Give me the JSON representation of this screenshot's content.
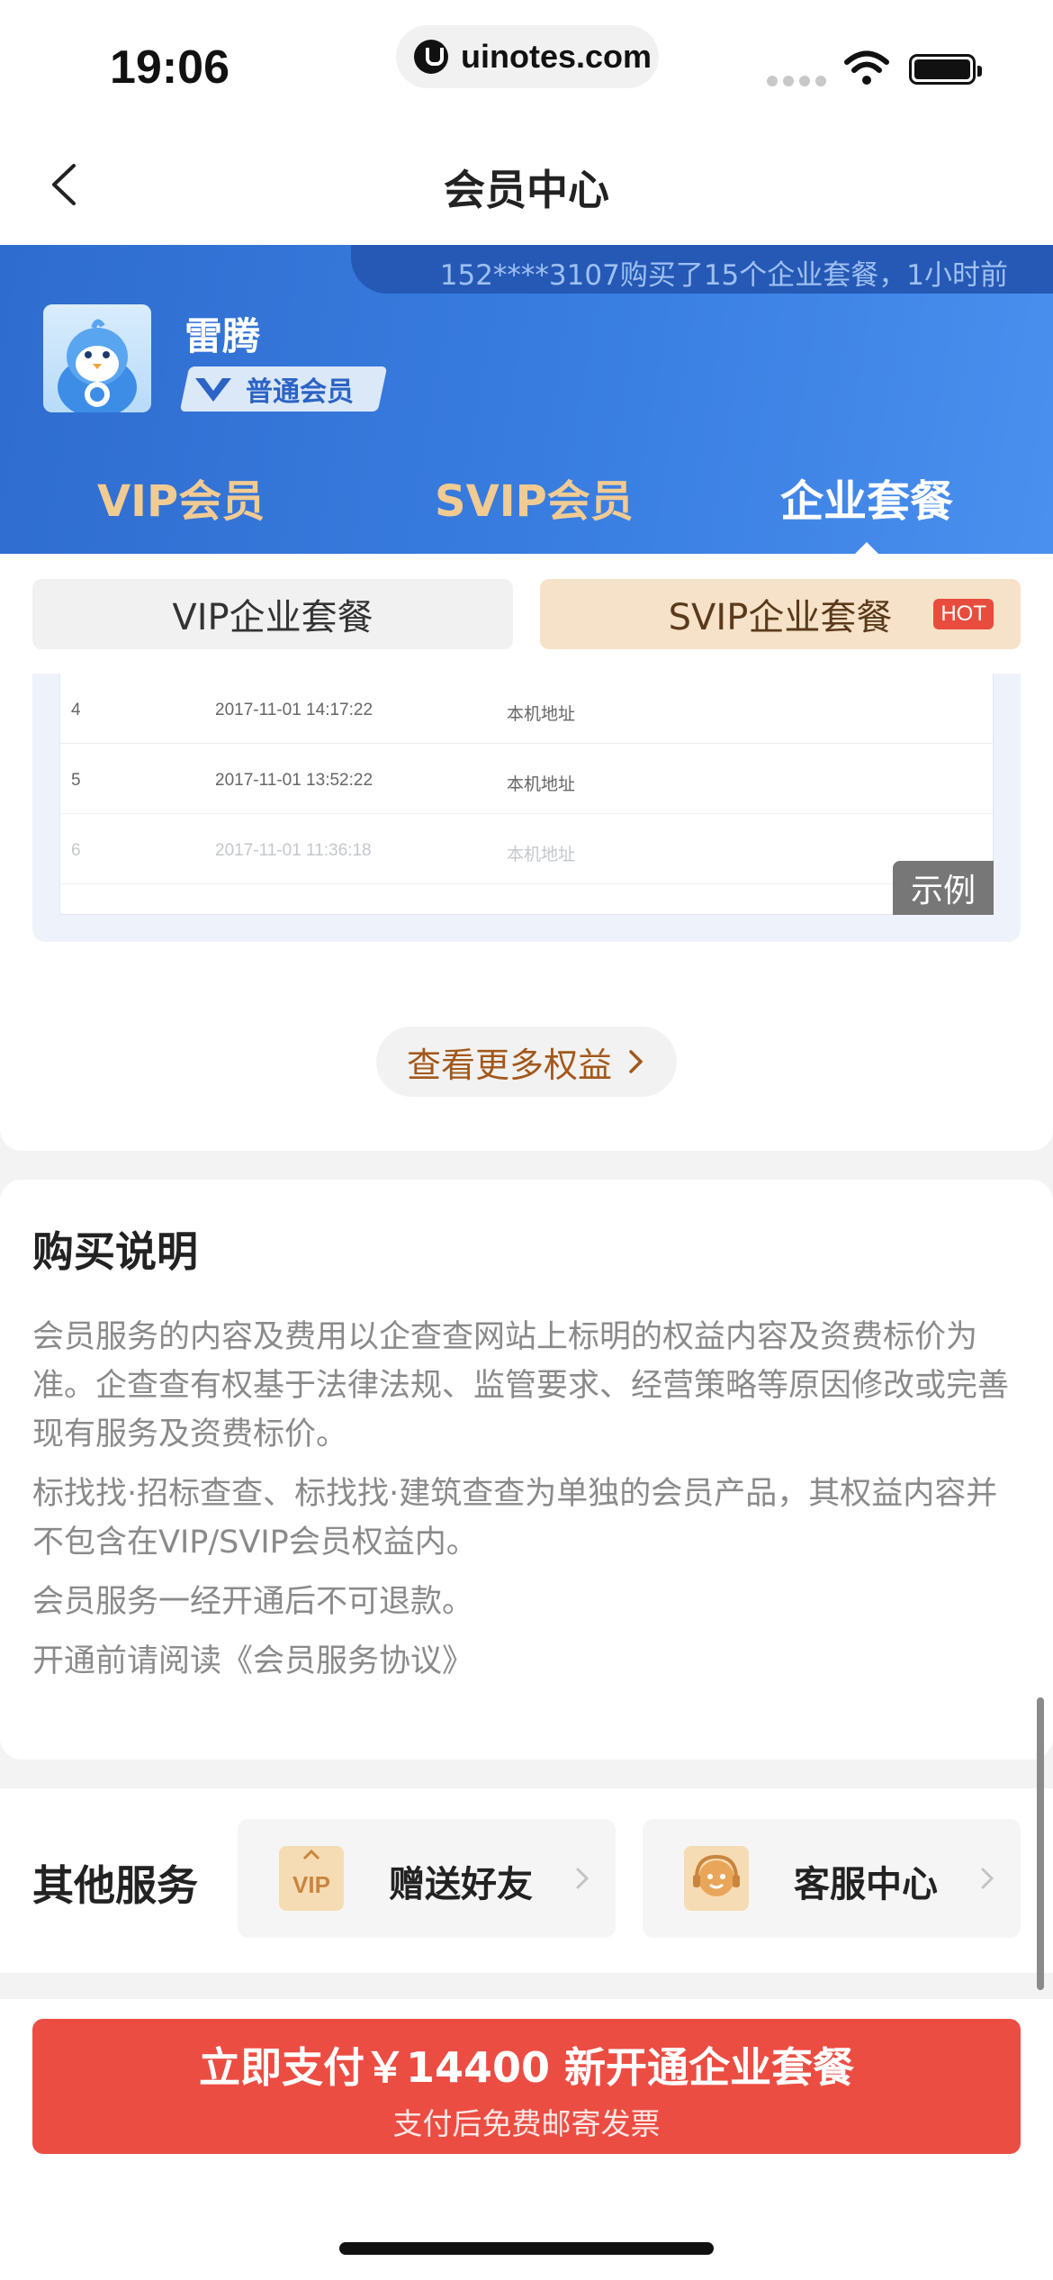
{
  "status_bar": {
    "time": "19:06",
    "url": "uinotes.com"
  },
  "nav": {
    "title": "会员中心"
  },
  "header": {
    "ticker": "152****3107购买了15个企业套餐，1小时前",
    "user_name": "雷腾",
    "member_level": "普通会员",
    "tabs": [
      {
        "label": "VIP会员",
        "active": false
      },
      {
        "label": "SVIP会员",
        "active": false
      },
      {
        "label": "企业套餐",
        "active": true
      }
    ]
  },
  "subtabs": [
    {
      "label": "VIP企业套餐",
      "selected": false
    },
    {
      "label": "SVIP企业套餐",
      "selected": true,
      "badge": "HOT"
    }
  ],
  "example": {
    "rows": [
      {
        "idx": "4",
        "time": "2017-11-01 14:17:22",
        "address": "本机地址"
      },
      {
        "idx": "5",
        "time": "2017-11-01 13:52:22",
        "address": "本机地址"
      },
      {
        "idx": "6",
        "time": "2017-11-01 11:36:18",
        "address": "本机地址"
      }
    ],
    "label": "示例",
    "more_button": "查看更多权益"
  },
  "purchase_notes": {
    "title": "购买说明",
    "paragraphs": [
      "会员服务的内容及费用以企查查网站上标明的权益内容及资费标价为准。企查查有权基于法律法规、监管要求、经营策略等原因修改或完善现有服务及资费标价。",
      "标找找·招标查查、标找找·建筑查查为单独的会员产品，其权益内容并不包含在VIP/SVIP会员权益内。",
      "会员服务一经开通后不可退款。",
      "开通前请阅读《会员服务协议》"
    ]
  },
  "other_services": {
    "title": "其他服务",
    "items": [
      {
        "label": "赠送好友",
        "icon": "vip-gift-icon",
        "icon_text": "VIP"
      },
      {
        "label": "客服中心",
        "icon": "customer-service-icon"
      }
    ]
  },
  "pay": {
    "main": "立即支付￥14400 新开通企业套餐",
    "sub": "支付后免费邮寄发票"
  },
  "colors": {
    "header_blue": "#3a7fe2",
    "tab_gold": "#f1cb92",
    "pay_red": "#ec4d43",
    "accent_brown": "#a2581b"
  }
}
